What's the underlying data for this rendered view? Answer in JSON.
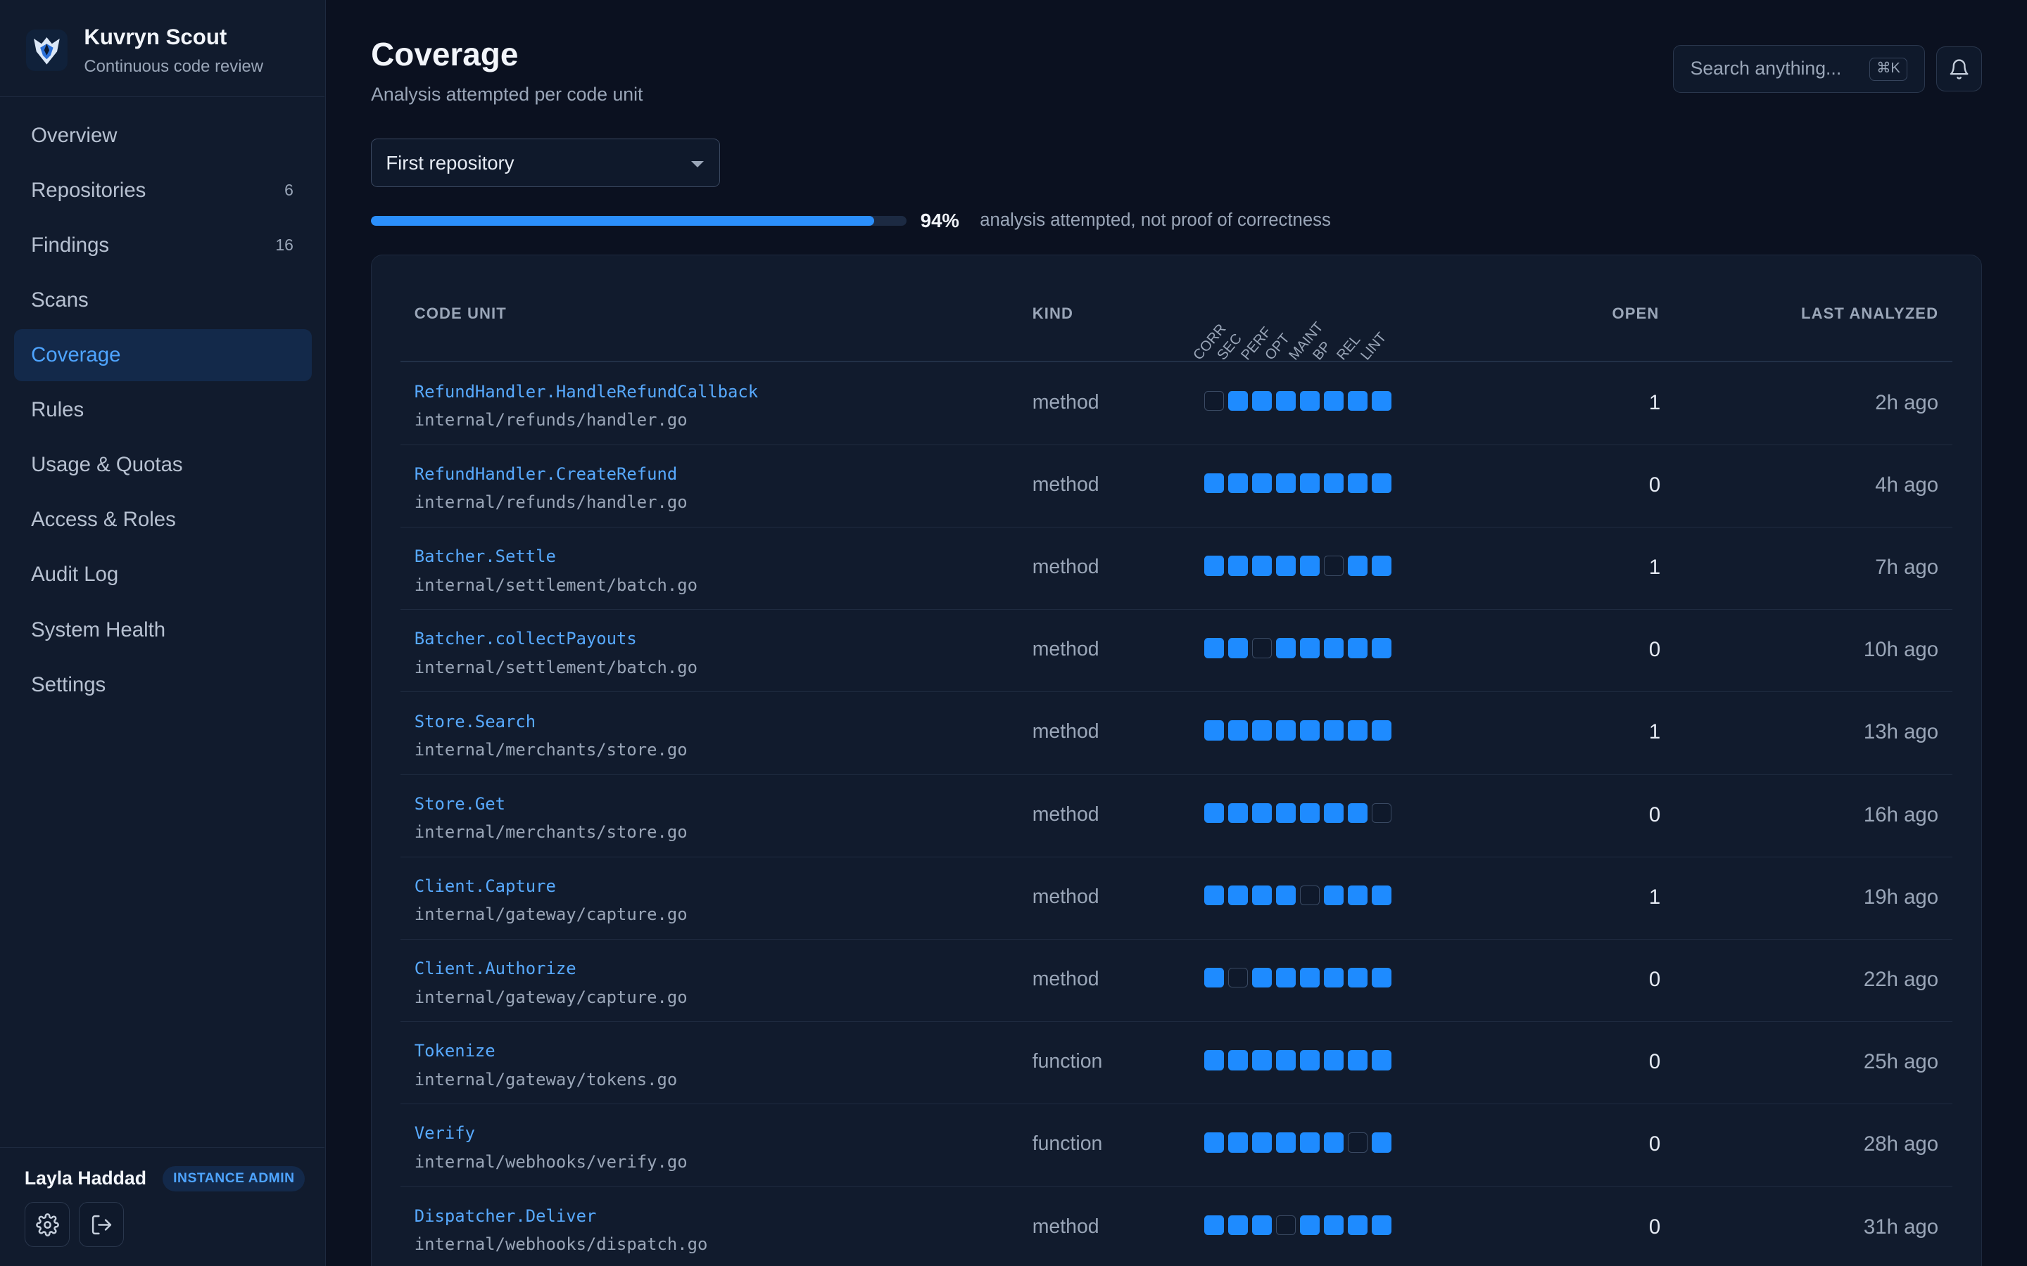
{
  "brand": {
    "title": "Kuvryn Scout",
    "subtitle": "Continuous code review",
    "logo_icon": "wolf-logo"
  },
  "nav": [
    {
      "label": "Overview",
      "count": ""
    },
    {
      "label": "Repositories",
      "count": "6"
    },
    {
      "label": "Findings",
      "count": "16"
    },
    {
      "label": "Scans",
      "count": ""
    },
    {
      "label": "Coverage",
      "count": "",
      "active": true
    },
    {
      "label": "Rules",
      "count": ""
    },
    {
      "label": "Usage & Quotas",
      "count": ""
    },
    {
      "label": "Access & Roles",
      "count": ""
    },
    {
      "label": "Audit Log",
      "count": ""
    },
    {
      "label": "System Health",
      "count": ""
    },
    {
      "label": "Settings",
      "count": ""
    }
  ],
  "user": {
    "name": "Layla Haddad",
    "role": "INSTANCE ADMIN",
    "settings_icon": "gear-icon",
    "logout_icon": "logout-icon"
  },
  "header": {
    "title": "Coverage",
    "subtitle": "Analysis attempted per code unit"
  },
  "search": {
    "placeholder": "Search anything...",
    "shortcut": "⌘K"
  },
  "notifications_icon": "bell-icon",
  "repo_select": {
    "value": "First repository"
  },
  "progress": {
    "value": 0.94,
    "label": "94%",
    "note": "analysis attempted, not proof of correctness"
  },
  "table": {
    "columns": {
      "unit": "CODE UNIT",
      "kind": "KIND",
      "open": "OPEN",
      "last": "LAST ANALYZED"
    },
    "categories": [
      "CORR",
      "SEC",
      "PERF",
      "OPT",
      "MAINT",
      "BP",
      "REL",
      "LINT"
    ],
    "rows": [
      {
        "name": "RefundHandler.HandleRefundCallback",
        "path": "internal/refunds/handler.go",
        "kind": "method",
        "coverage": [
          0,
          1,
          1,
          1,
          1,
          1,
          1,
          1
        ],
        "open": "1",
        "last": "2h ago"
      },
      {
        "name": "RefundHandler.CreateRefund",
        "path": "internal/refunds/handler.go",
        "kind": "method",
        "coverage": [
          1,
          1,
          1,
          1,
          1,
          1,
          1,
          1
        ],
        "open": "0",
        "last": "4h ago"
      },
      {
        "name": "Batcher.Settle",
        "path": "internal/settlement/batch.go",
        "kind": "method",
        "coverage": [
          1,
          1,
          1,
          1,
          1,
          0,
          1,
          1
        ],
        "open": "1",
        "last": "7h ago"
      },
      {
        "name": "Batcher.collectPayouts",
        "path": "internal/settlement/batch.go",
        "kind": "method",
        "coverage": [
          1,
          1,
          0,
          1,
          1,
          1,
          1,
          1
        ],
        "open": "0",
        "last": "10h ago"
      },
      {
        "name": "Store.Search",
        "path": "internal/merchants/store.go",
        "kind": "method",
        "coverage": [
          1,
          1,
          1,
          1,
          1,
          1,
          1,
          1
        ],
        "open": "1",
        "last": "13h ago"
      },
      {
        "name": "Store.Get",
        "path": "internal/merchants/store.go",
        "kind": "method",
        "coverage": [
          1,
          1,
          1,
          1,
          1,
          1,
          1,
          0
        ],
        "open": "0",
        "last": "16h ago"
      },
      {
        "name": "Client.Capture",
        "path": "internal/gateway/capture.go",
        "kind": "method",
        "coverage": [
          1,
          1,
          1,
          1,
          0,
          1,
          1,
          1
        ],
        "open": "1",
        "last": "19h ago"
      },
      {
        "name": "Client.Authorize",
        "path": "internal/gateway/capture.go",
        "kind": "method",
        "coverage": [
          1,
          0,
          1,
          1,
          1,
          1,
          1,
          1
        ],
        "open": "0",
        "last": "22h ago"
      },
      {
        "name": "Tokenize",
        "path": "internal/gateway/tokens.go",
        "kind": "function",
        "coverage": [
          1,
          1,
          1,
          1,
          1,
          1,
          1,
          1
        ],
        "open": "0",
        "last": "25h ago"
      },
      {
        "name": "Verify",
        "path": "internal/webhooks/verify.go",
        "kind": "function",
        "coverage": [
          1,
          1,
          1,
          1,
          1,
          1,
          0,
          1
        ],
        "open": "0",
        "last": "28h ago"
      },
      {
        "name": "Dispatcher.Deliver",
        "path": "internal/webhooks/dispatch.go",
        "kind": "method",
        "coverage": [
          1,
          1,
          1,
          0,
          1,
          1,
          1,
          1
        ],
        "open": "0",
        "last": "31h ago"
      }
    ]
  }
}
